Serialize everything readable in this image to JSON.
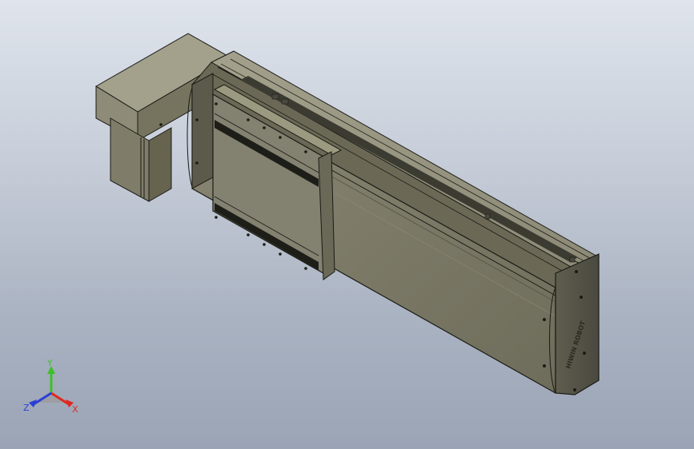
{
  "viewport": {
    "background_top": "#dfe4ec",
    "background_bottom": "#9aa4b5",
    "model_color": "#7d7b68",
    "model_edge_color": "#1b1b16"
  },
  "model": {
    "brand_label": "HIWIN ROBOT"
  },
  "triad": {
    "x_label": "X",
    "y_label": "Y",
    "z_label": "Z",
    "x_color": "#e0281e",
    "y_color": "#3fbf2a",
    "z_color": "#2a3fd6"
  }
}
